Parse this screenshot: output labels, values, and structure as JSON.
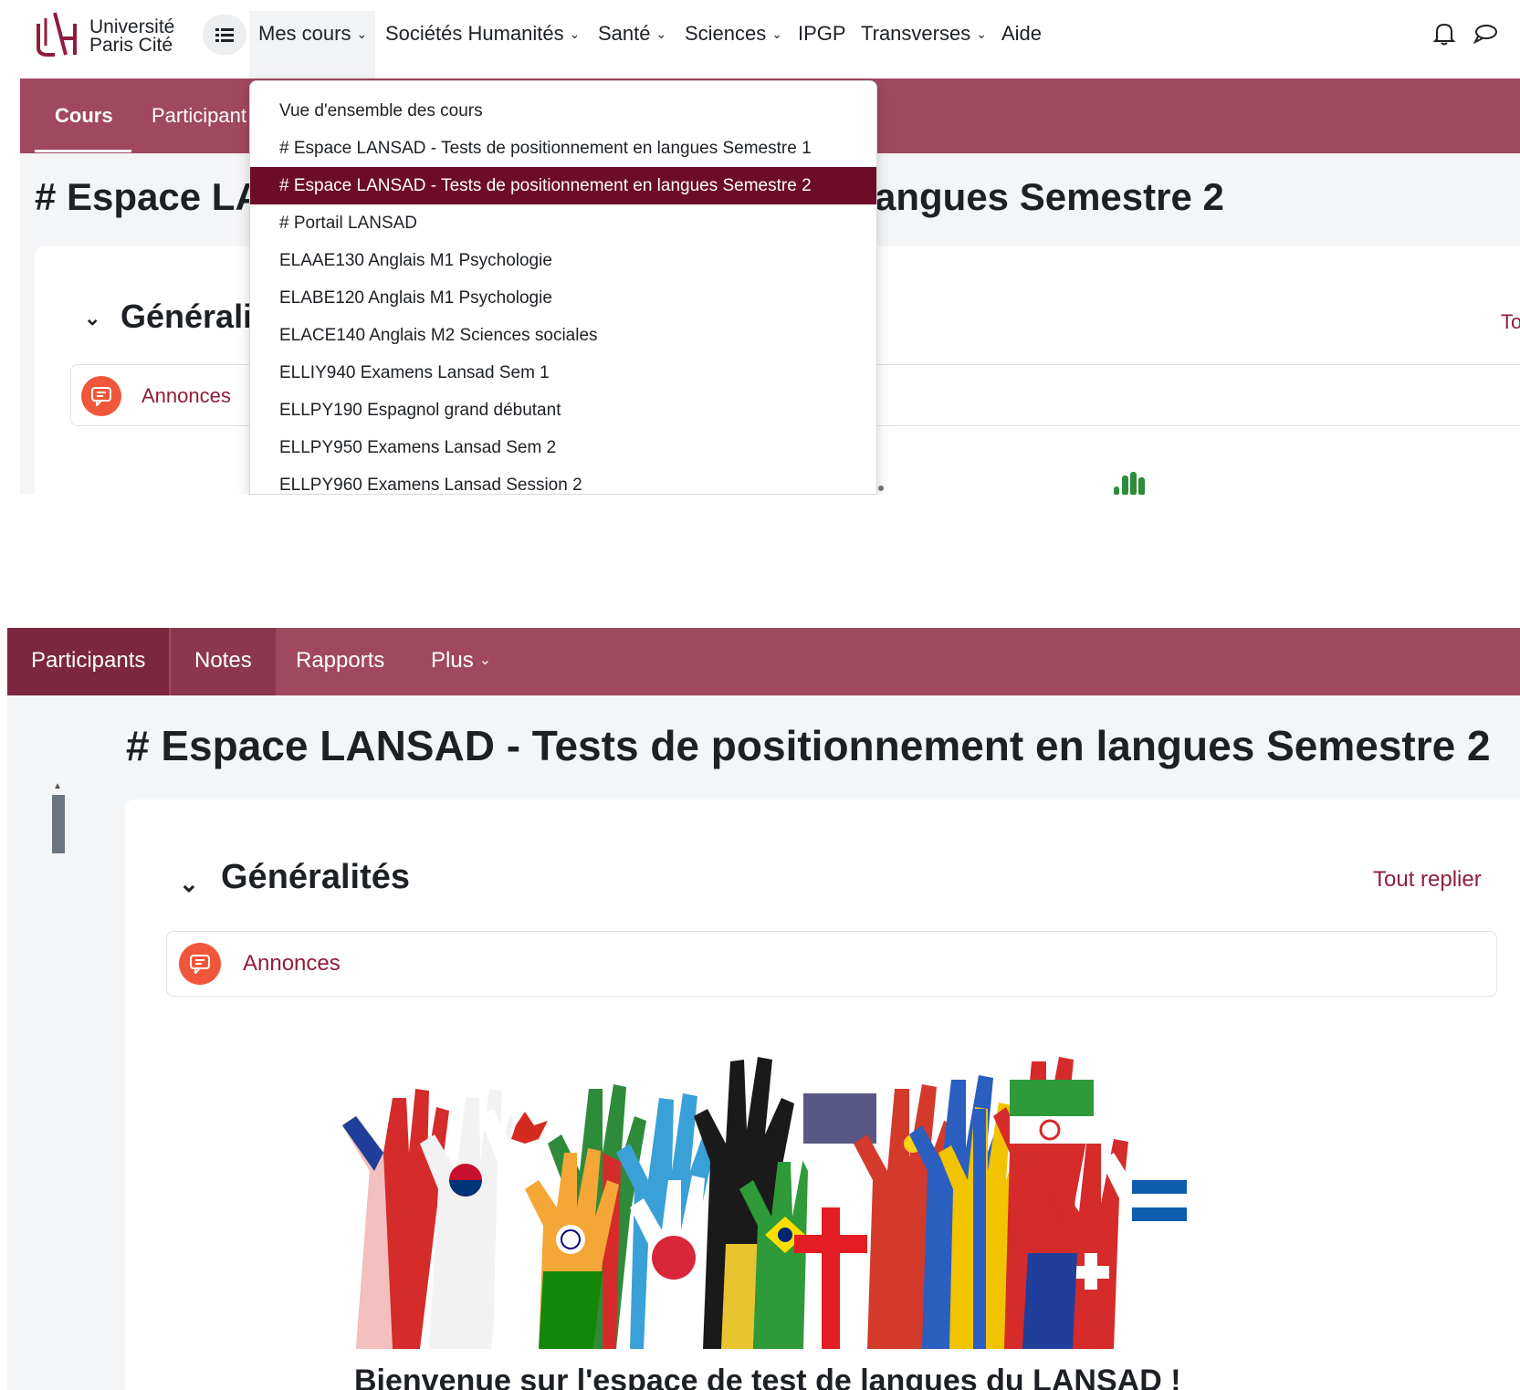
{
  "navbar": {
    "logo_line1": "Université",
    "logo_line2": "Paris Cité",
    "items": [
      {
        "label": "Mes cours",
        "dropdown": true
      },
      {
        "label": "Sociétés Humanités",
        "dropdown": true
      },
      {
        "label": "Santé",
        "dropdown": true
      },
      {
        "label": "Sciences",
        "dropdown": true
      },
      {
        "label": "IPGP",
        "dropdown": false
      },
      {
        "label": "Transverses",
        "dropdown": true
      },
      {
        "label": "Aide",
        "dropdown": false
      }
    ],
    "icons": [
      "grid-menu-icon",
      "bell-icon",
      "message-icon"
    ]
  },
  "course_nav_top": {
    "tabs": [
      "Cours",
      "Participant"
    ]
  },
  "dropdown": {
    "items": [
      "Vue d'ensemble des cours",
      "# Espace LANSAD - Tests de positionnement en langues Semestre 1",
      "# Espace LANSAD - Tests de positionnement en langues Semestre 2",
      "# Portail LANSAD",
      "ELAAE130 Anglais M1 Psychologie",
      "ELABE120 Anglais M1 Psychologie",
      "ELACE140 Anglais M2 Sciences sociales",
      "ELLIY940 Examens Lansad Sem 1",
      "ELLPY190 Espagnol grand débutant",
      "ELLPY950 Examens Lansad Sem 2",
      "ELLPY960 Examens Lansad Session 2"
    ],
    "active_index": 2
  },
  "top_page": {
    "title_left": "# Espace LA",
    "title_right": "angues Semestre 2",
    "section_title": "Généralit",
    "collapse_cut": "To",
    "announcement": "Annonces"
  },
  "course_nav_bottom": {
    "tabs": [
      "Participants",
      "Notes",
      "Rapports",
      "Plus"
    ]
  },
  "page": {
    "title": "# Espace LANSAD - Tests de positionnement en langues Semestre 2",
    "section_title": "Généralités",
    "collapse_all": "Tout replier",
    "announcement": "Annonces",
    "banner_alt": "raised hands painted with world flags",
    "welcome": "Bienvenue sur l'espace de test de langues du LANSAD !"
  },
  "colors": {
    "brand": "#a0485f",
    "brand_dark": "#7c263f",
    "active_item": "#6d0c28",
    "link": "#8f1d3d",
    "announce_icon": "#f0573a"
  }
}
